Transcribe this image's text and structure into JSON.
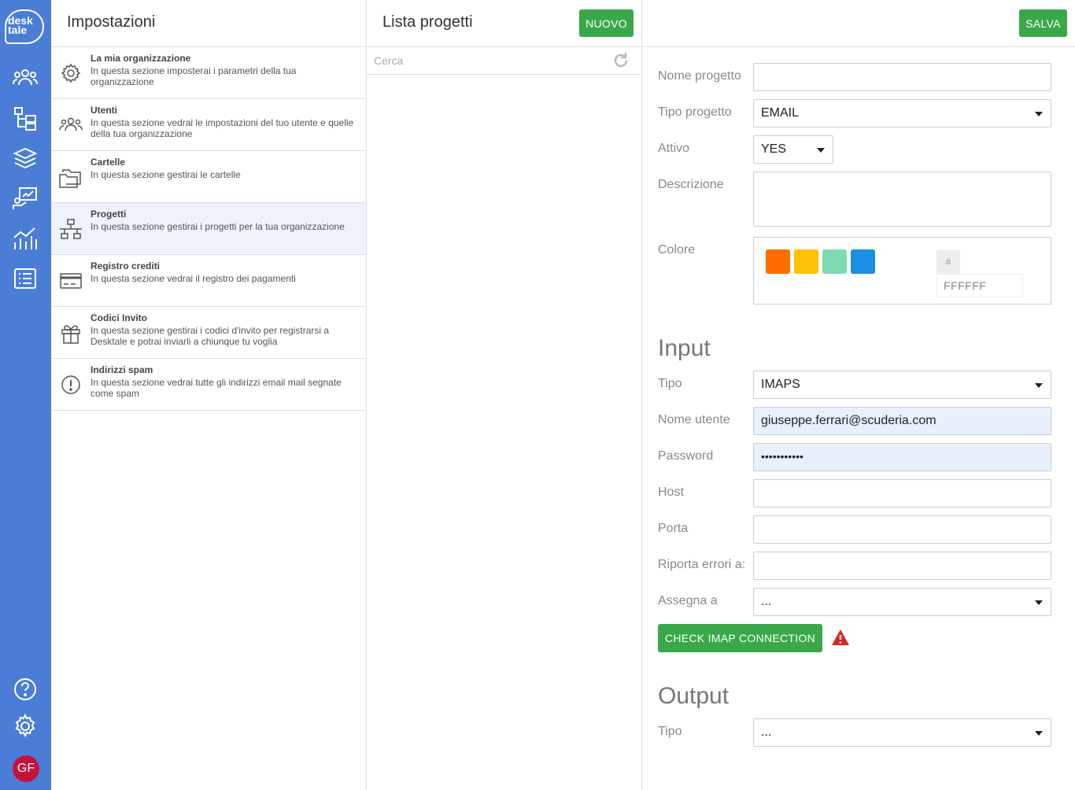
{
  "rail": {
    "logo_line1": "desk",
    "logo_line2": "tale",
    "icons": [
      "users-icon",
      "folders-tree-icon",
      "layers-icon",
      "presentation-icon",
      "chart-icon",
      "list-icon"
    ],
    "bottom_icons": [
      "help-icon",
      "settings-icon"
    ],
    "avatar_initials": "GF",
    "avatar_color": "#c4123a",
    "color": "#4a7dd6"
  },
  "settings": {
    "title": "Impostazioni",
    "items": [
      {
        "title": "La mia organizzazione",
        "desc": "In questa sezione imposterai i parametri della tua organizzazione",
        "icon": "gear-icon"
      },
      {
        "title": "Utenti",
        "desc": "In questa sezione vedrai le impostazioni del tuo utente e quelle della tua organizzazione",
        "icon": "users-icon"
      },
      {
        "title": "Cartelle",
        "desc": "In questa sezione gestirai le cartelle",
        "icon": "folder-icon"
      },
      {
        "title": "Progetti",
        "desc": "In questa sezione gestirai i progetti per la tua organizzazione",
        "icon": "org-chart-icon"
      },
      {
        "title": "Registro crediti",
        "desc": "In questa sezione vedrai il registro dei pagamenti",
        "icon": "credit-card-icon"
      },
      {
        "title": "Codici Invito",
        "desc": "In questa sezione gestirai i codici d'invito per registrarsi a Desktale e potrai inviarli a chiunque tu voglia",
        "icon": "gift-icon"
      },
      {
        "title": "Indirizzi spam",
        "desc": "In questa sezione vedrai tutte gli indirizzi email mail segnate come spam",
        "icon": "alert-circle-icon"
      }
    ]
  },
  "projects": {
    "title": "Lista progetti",
    "new_label": "NUOVO",
    "search_placeholder": "Cerca"
  },
  "form": {
    "save_label": "SALVA",
    "labels": {
      "nome_progetto": "Nome progetto",
      "tipo_progetto": "Tipo progetto",
      "attivo": "Attivo",
      "descrizione": "Descrizione",
      "colore": "Colore"
    },
    "values": {
      "nome_progetto": "",
      "tipo_progetto": "EMAIL",
      "attivo": "YES",
      "descrizione": ""
    },
    "swatches": [
      "#ff6d00",
      "#ffc107",
      "#7ddbb3",
      "#1a8fe3"
    ],
    "hash": "#",
    "hex": "FFFFFF",
    "input_section": "Input",
    "input": {
      "tipo_label": "Tipo",
      "tipo_value": "IMAPS",
      "user_label": "Nome utente",
      "user_value": "giuseppe.ferrari@scuderia.com",
      "password_label": "Password",
      "password_value": "•••••••••••",
      "host_label": "Host",
      "host_value": "",
      "porta_label": "Porta",
      "porta_value": "",
      "errori_label": "Riporta errori a:",
      "errori_value": "",
      "assegna_label": "Assegna a",
      "assegna_value": "..."
    },
    "check_label": "CHECK IMAP CONNECTION",
    "output_section": "Output",
    "output": {
      "tipo_label": "Tipo",
      "tipo_value": "..."
    },
    "accent_green": "#3aa84a",
    "warning_color": "#e02020"
  }
}
